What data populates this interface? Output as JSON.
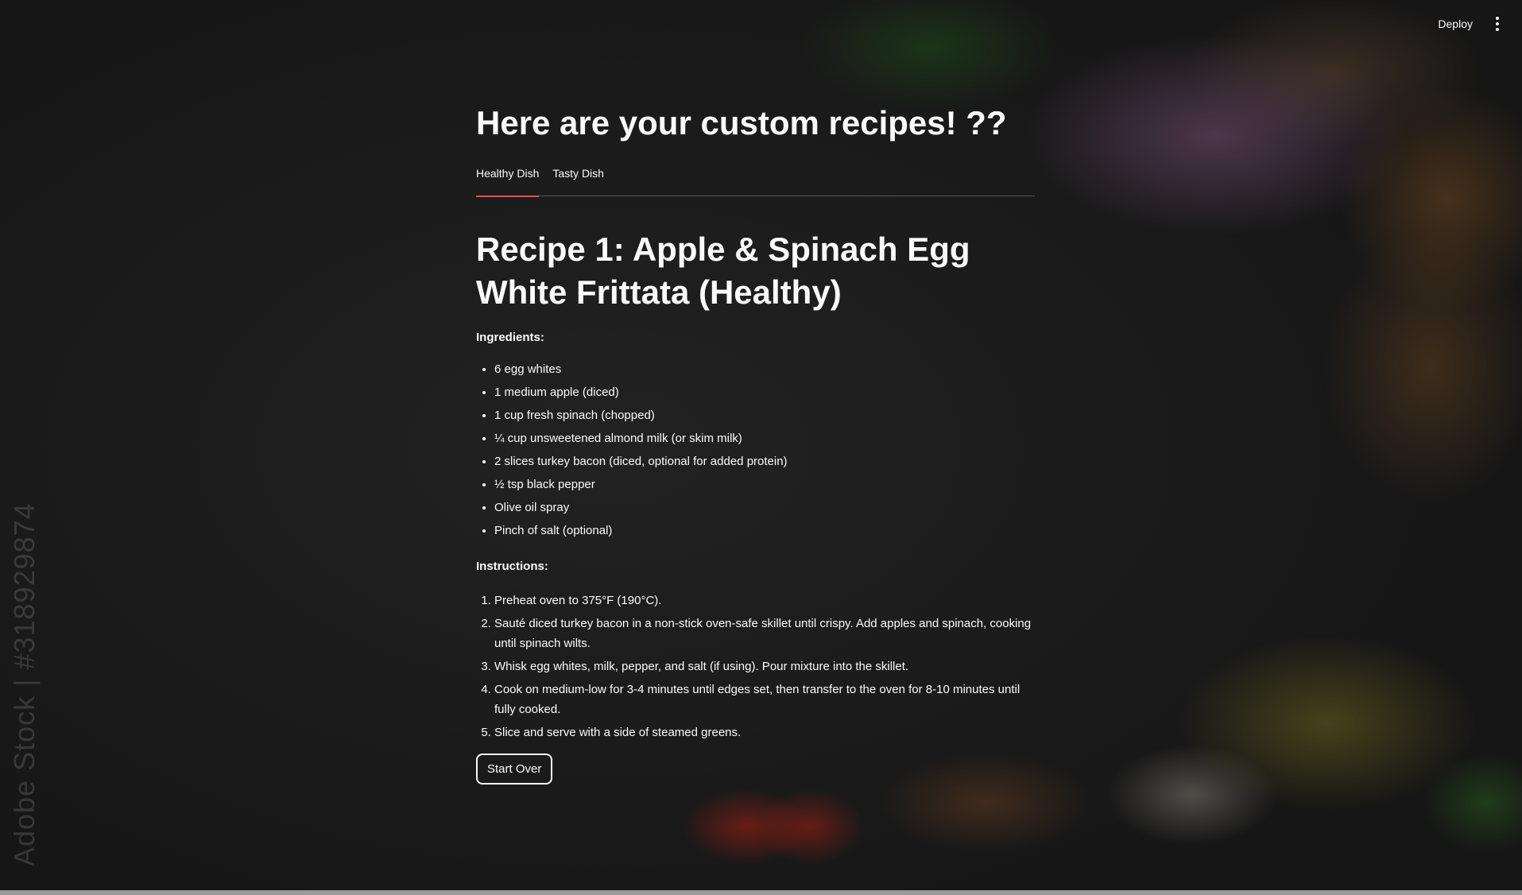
{
  "header": {
    "deploy_label": "Deploy",
    "menu_icon": "vertical-ellipsis-icon"
  },
  "watermark": "Adobe Stock | #318929874",
  "main": {
    "title": "Here are your custom recipes! ??",
    "tabs": [
      {
        "label": "Healthy Dish",
        "active": true
      },
      {
        "label": "Tasty Dish",
        "active": false
      }
    ],
    "recipe": {
      "title": "Recipe 1: Apple & Spinach Egg White Frittata (Healthy)",
      "ingredients_label": "Ingredients:",
      "ingredients": [
        "6 egg whites",
        "1 medium apple (diced)",
        "1 cup fresh spinach (chopped)",
        "¼ cup unsweetened almond milk (or skim milk)",
        "2 slices turkey bacon (diced, optional for added protein)",
        "½ tsp black pepper",
        "Olive oil spray",
        "Pinch of salt (optional)"
      ],
      "instructions_label": "Instructions:",
      "instructions": [
        "Preheat oven to 375°F (190°C).",
        "Sauté diced turkey bacon in a non-stick oven-safe skillet until crispy. Add apples and spinach, cooking until spinach wilts.",
        "Whisk egg whites, milk, pepper, and salt (if using). Pour mixture into the skillet.",
        "Cook on medium-low for 3-4 minutes until edges set, then transfer to the oven for 8-10 minutes until fully cooked.",
        "Slice and serve with a side of steamed greens."
      ]
    },
    "start_over_label": "Start Over"
  },
  "colors": {
    "accent": "#ff4b4b",
    "text": "#fafafa",
    "background": "#1b1b1b"
  }
}
